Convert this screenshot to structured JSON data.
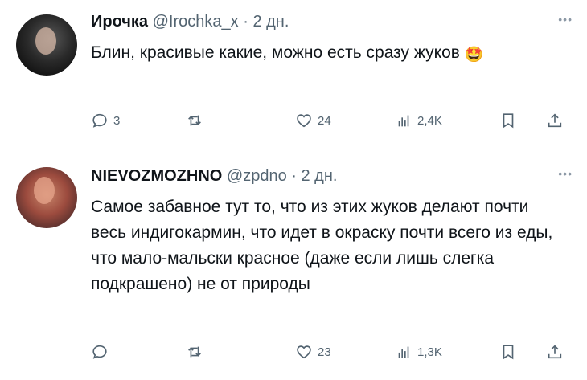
{
  "tweets": [
    {
      "name": "Ирочка",
      "handle": "@Irochka_x",
      "separator": "·",
      "time": "2 дн.",
      "text": "Блин, красивые какие, можно есть сразу жуков",
      "emoji": "🤩",
      "replies": "3",
      "retweets": "",
      "likes": "24",
      "views": "2,4K"
    },
    {
      "name": "NIEVOZMOZHNO",
      "handle": "@zpdno",
      "separator": "·",
      "time": "2 дн.",
      "text": "Самое забавное тут то, что из этих жуков делают почти весь индигокармин, что идет в окраску почти всего из еды, что мало-мальски красное (даже если лишь слегка подкрашено) не от природы",
      "replies": "",
      "retweets": "",
      "likes": "23",
      "views": "1,3K"
    }
  ],
  "icons": {
    "reply": "reply-icon",
    "retweet": "retweet-icon",
    "like": "heart-icon",
    "views": "views-icon",
    "bookmark": "bookmark-icon",
    "share": "share-icon",
    "more": "more-icon"
  },
  "colors": {
    "text": "#0f1419",
    "secondary": "#536471",
    "divider": "#e6e9ec"
  }
}
